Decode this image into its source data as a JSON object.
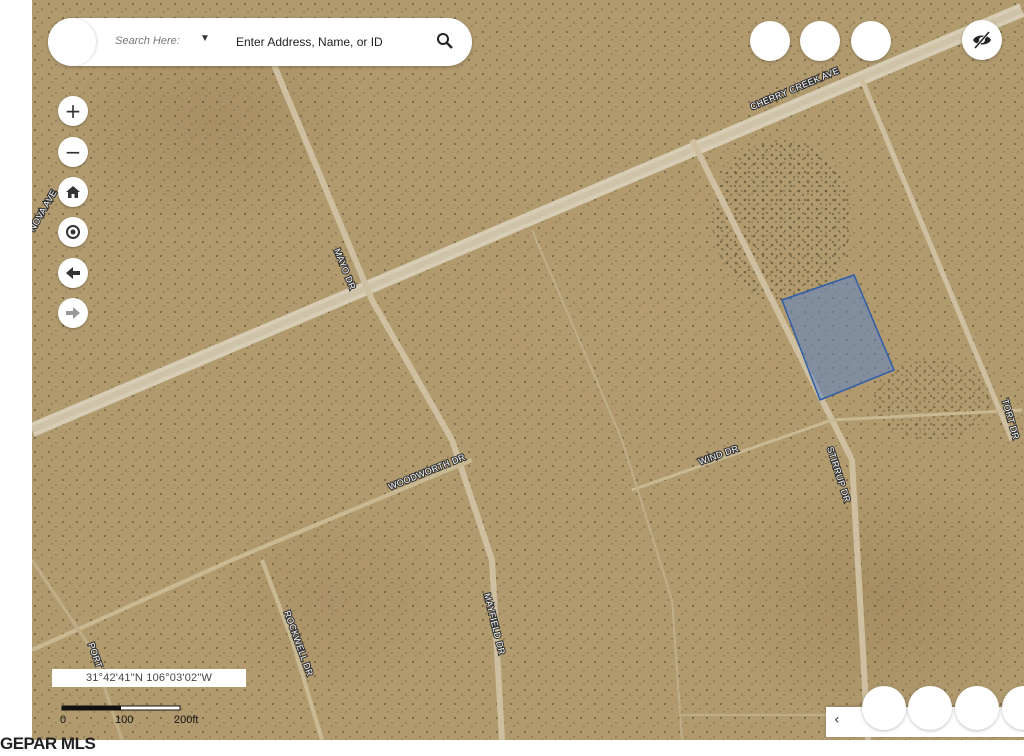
{
  "search": {
    "mode_label": "Search Here:",
    "placeholder": "Enter Address, Name, or ID"
  },
  "top_right_buttons": [
    "blank-1",
    "blank-2",
    "blank-3"
  ],
  "visibility_icon": "eye-slash-icon",
  "map_controls": {
    "zoom_in": "+",
    "zoom_out": "−",
    "home": "home-icon",
    "locate": "target-icon",
    "back": "arrow-left-icon",
    "forward": "arrow-right-icon"
  },
  "roads": [
    "CHERRY CREEK AVE",
    "NOVA AVE",
    "MAYO DR",
    "WOODWORTH DR",
    "WIND DR",
    "STIRRUP DR",
    "ROCKWELL DR",
    "MAYFIELD DR",
    "PORT DR",
    "TORT DR"
  ],
  "coordinates": "31°42'41\"N 106°03'02\"W",
  "scale": {
    "labels": [
      "0",
      "100",
      "200ft"
    ]
  },
  "attribution": "GEPAR MLS",
  "bottom_panel": {
    "back_icon": "‹"
  }
}
